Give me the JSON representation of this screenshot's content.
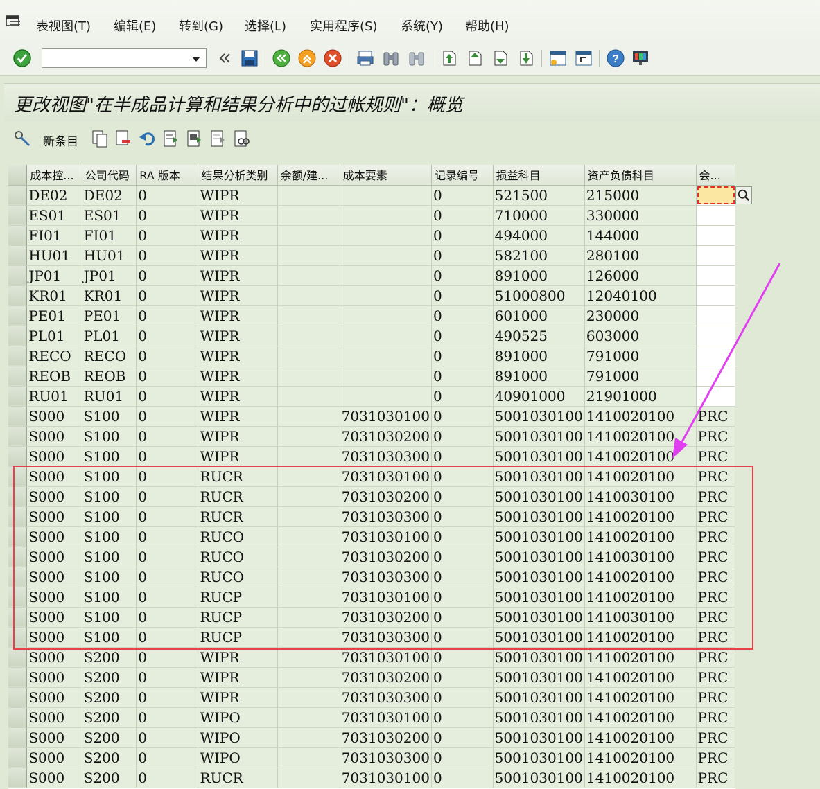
{
  "menu": {
    "items": [
      "表视图(T)",
      "编辑(E)",
      "转到(G)",
      "选择(L)",
      "实用程序(S)",
      "系统(Y)",
      "帮助(H)"
    ]
  },
  "toolbar": {
    "command_field_value": "",
    "icons": [
      "enter-icon",
      "command-field",
      "back-double-arrow-icon",
      "save-icon",
      "back-icon",
      "exit-icon",
      "cancel-icon",
      "print-icon",
      "find-icon",
      "find-next-icon",
      "first-page-icon",
      "previous-page-icon",
      "next-page-icon",
      "last-page-icon",
      "create-session-icon",
      "shortcut-icon",
      "help-icon",
      "customize-layout-icon"
    ]
  },
  "title": "更改视图\"在半成品计算和结果分析中的过帐规则\"：概览",
  "app_toolbar": {
    "new_entries_label": "新条目"
  },
  "table": {
    "columns": [
      "成本控...",
      "公司代码",
      "RA 版本",
      "结果分析类别",
      "余额/建...",
      "成本要素",
      "记录编号",
      "损益科目",
      "资产负债科目",
      "会..."
    ],
    "rows": [
      [
        "DE02",
        "DE02",
        "0",
        "WIPR",
        "",
        "",
        "0",
        "521500",
        "215000",
        ""
      ],
      [
        "ES01",
        "ES01",
        "0",
        "WIPR",
        "",
        "",
        "0",
        "710000",
        "330000",
        ""
      ],
      [
        "FI01",
        "FI01",
        "0",
        "WIPR",
        "",
        "",
        "0",
        "494000",
        "144000",
        ""
      ],
      [
        "HU01",
        "HU01",
        "0",
        "WIPR",
        "",
        "",
        "0",
        "582100",
        "280100",
        ""
      ],
      [
        "JP01",
        "JP01",
        "0",
        "WIPR",
        "",
        "",
        "0",
        "891000",
        "126000",
        ""
      ],
      [
        "KR01",
        "KR01",
        "0",
        "WIPR",
        "",
        "",
        "0",
        "51000800",
        "12040100",
        ""
      ],
      [
        "PE01",
        "PE01",
        "0",
        "WIPR",
        "",
        "",
        "0",
        "601000",
        "230000",
        ""
      ],
      [
        "PL01",
        "PL01",
        "0",
        "WIPR",
        "",
        "",
        "0",
        "490525",
        "603000",
        ""
      ],
      [
        "RECO",
        "RECO",
        "0",
        "WIPR",
        "",
        "",
        "0",
        "891000",
        "791000",
        ""
      ],
      [
        "REOB",
        "REOB",
        "0",
        "WIPR",
        "",
        "",
        "0",
        "891000",
        "791000",
        ""
      ],
      [
        "RU01",
        "RU01",
        "0",
        "WIPR",
        "",
        "",
        "0",
        "40901000",
        "21901000",
        ""
      ],
      [
        "S000",
        "S100",
        "0",
        "WIPR",
        "",
        "7031030100",
        "0",
        "5001030100",
        "1410020100",
        "PRC"
      ],
      [
        "S000",
        "S100",
        "0",
        "WIPR",
        "",
        "7031030200",
        "0",
        "5001030100",
        "1410020100",
        "PRC"
      ],
      [
        "S000",
        "S100",
        "0",
        "WIPR",
        "",
        "7031030300",
        "0",
        "5001030100",
        "1410020100",
        "PRC"
      ],
      [
        "S000",
        "S100",
        "0",
        "RUCR",
        "",
        "7031030100",
        "0",
        "5001030100",
        "1410020100",
        "PRC"
      ],
      [
        "S000",
        "S100",
        "0",
        "RUCR",
        "",
        "7031030200",
        "0",
        "5001030100",
        "1410030100",
        "PRC"
      ],
      [
        "S000",
        "S100",
        "0",
        "RUCR",
        "",
        "7031030300",
        "0",
        "5001030100",
        "1410020100",
        "PRC"
      ],
      [
        "S000",
        "S100",
        "0",
        "RUCO",
        "",
        "7031030100",
        "0",
        "5001030100",
        "1410020100",
        "PRC"
      ],
      [
        "S000",
        "S100",
        "0",
        "RUCO",
        "",
        "7031030200",
        "0",
        "5001030100",
        "1410030100",
        "PRC"
      ],
      [
        "S000",
        "S100",
        "0",
        "RUCO",
        "",
        "7031030300",
        "0",
        "5001030100",
        "1410020100",
        "PRC"
      ],
      [
        "S000",
        "S100",
        "0",
        "RUCP",
        "",
        "7031030100",
        "0",
        "5001030100",
        "1410020100",
        "PRC"
      ],
      [
        "S000",
        "S100",
        "0",
        "RUCP",
        "",
        "7031030200",
        "0",
        "5001030100",
        "1410030100",
        "PRC"
      ],
      [
        "S000",
        "S100",
        "0",
        "RUCP",
        "",
        "7031030300",
        "0",
        "5001030100",
        "1410020100",
        "PRC"
      ],
      [
        "S000",
        "S200",
        "0",
        "WIPR",
        "",
        "7031030100",
        "0",
        "5001030100",
        "1410020100",
        "PRC"
      ],
      [
        "S000",
        "S200",
        "0",
        "WIPR",
        "",
        "7031030200",
        "0",
        "5001030100",
        "1410020100",
        "PRC"
      ],
      [
        "S000",
        "S200",
        "0",
        "WIPR",
        "",
        "7031030300",
        "0",
        "5001030100",
        "1410020100",
        "PRC"
      ],
      [
        "S000",
        "S200",
        "0",
        "WIPO",
        "",
        "7031030100",
        "0",
        "5001030100",
        "1410020100",
        "PRC"
      ],
      [
        "S000",
        "S200",
        "0",
        "WIPO",
        "",
        "7031030200",
        "0",
        "5001030100",
        "1410020100",
        "PRC"
      ],
      [
        "S000",
        "S200",
        "0",
        "WIPO",
        "",
        "7031030300",
        "0",
        "5001030100",
        "1410020100",
        "PRC"
      ],
      [
        "S000",
        "S200",
        "0",
        "RUCR",
        "",
        "7031030100",
        "0",
        "5001030100",
        "1410020100",
        "PRC"
      ]
    ]
  },
  "colors": {
    "background": "#dfe9d5",
    "row": "#e5eddd",
    "highlight_border": "#e8414a",
    "arrow": "#e040f0",
    "focus_field": "#fbe7a1"
  }
}
